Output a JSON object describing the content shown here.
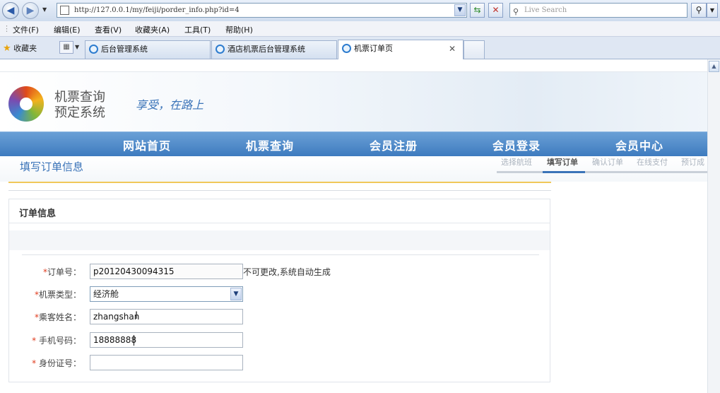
{
  "browser": {
    "url": "http://127.0.0.1/my/feiji/porder_info.php?id=4",
    "search_placeholder": "Live Search",
    "menu": [
      "文件(F)",
      "编辑(E)",
      "查看(V)",
      "收藏夹(A)",
      "工具(T)",
      "帮助(H)"
    ],
    "favorites_label": "收藏夹",
    "tabs": [
      {
        "label": "后台管理系统",
        "active": false
      },
      {
        "label": "酒店机票后台管理系统",
        "active": false
      },
      {
        "label": "机票订单页",
        "active": true
      }
    ]
  },
  "site": {
    "logo_line1": "机票查询",
    "logo_line2": "预定系统",
    "slogan": "享受，在路上",
    "nav": [
      "网站首页",
      "机票查询",
      "会员注册",
      "会员登录",
      "会员中心"
    ],
    "page_title": "填写订单信息",
    "steps": [
      "选择航班",
      "填写订单",
      "确认订单",
      "在线支付",
      "预订成"
    ]
  },
  "form": {
    "section_title": "订单信息",
    "order_no": {
      "label": "订单号：",
      "value": "p20120430094315",
      "hint": "不可更改,系统自动生成"
    },
    "ticket_type": {
      "label": "机票类型：",
      "value": "经济舱"
    },
    "passenger": {
      "label": "乘客姓名：",
      "value": "zhangshan"
    },
    "phone": {
      "label": "手机号码：",
      "value": "18888888"
    },
    "id_card": {
      "label": "身份证号：",
      "value": ""
    }
  },
  "colors": {
    "accent": "#3a73b8",
    "required": "#e03c1e",
    "nav_bg": "#4d8ac9",
    "gold_line": "#f0c85a"
  }
}
